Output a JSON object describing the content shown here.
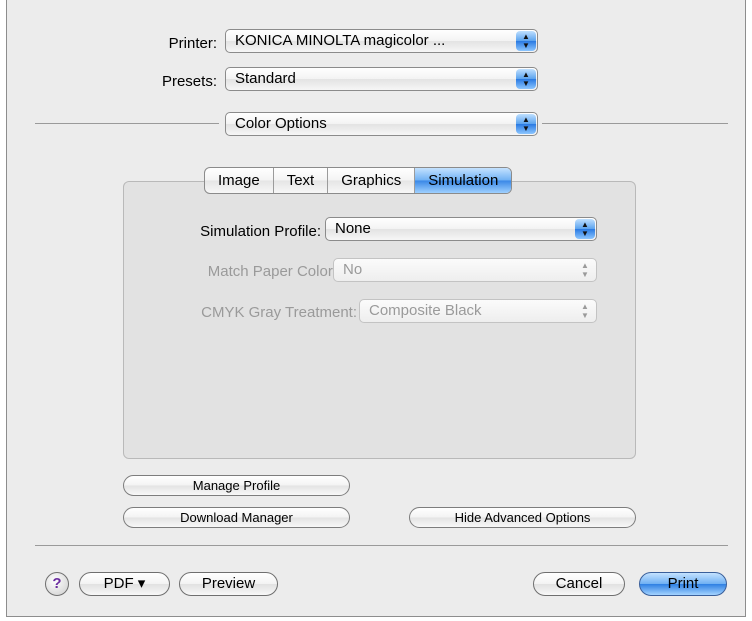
{
  "printer": {
    "label": "Printer:",
    "value": "KONICA MINOLTA magicolor ..."
  },
  "presets": {
    "label": "Presets:",
    "value": "Standard"
  },
  "panel": {
    "value": "Color Options"
  },
  "tabs": [
    {
      "label": "Image",
      "active": false
    },
    {
      "label": "Text",
      "active": false
    },
    {
      "label": "Graphics",
      "active": false
    },
    {
      "label": "Simulation",
      "active": true
    }
  ],
  "simulation": {
    "profile": {
      "label": "Simulation Profile:",
      "value": "None"
    },
    "paper_color": {
      "label": "Match Paper Color:",
      "value": "No"
    },
    "gray_treatment": {
      "label": "CMYK Gray Treatment:",
      "value": "Composite Black"
    }
  },
  "buttons": {
    "manage_profile": "Manage Profile",
    "download_manager": "Download Manager",
    "hide_advanced": "Hide Advanced Options",
    "help": "?",
    "pdf": "PDF ▾",
    "preview": "Preview",
    "cancel": "Cancel",
    "print": "Print"
  },
  "colors": {
    "accent": "#3a88e6",
    "window_bg": "#ececec"
  }
}
